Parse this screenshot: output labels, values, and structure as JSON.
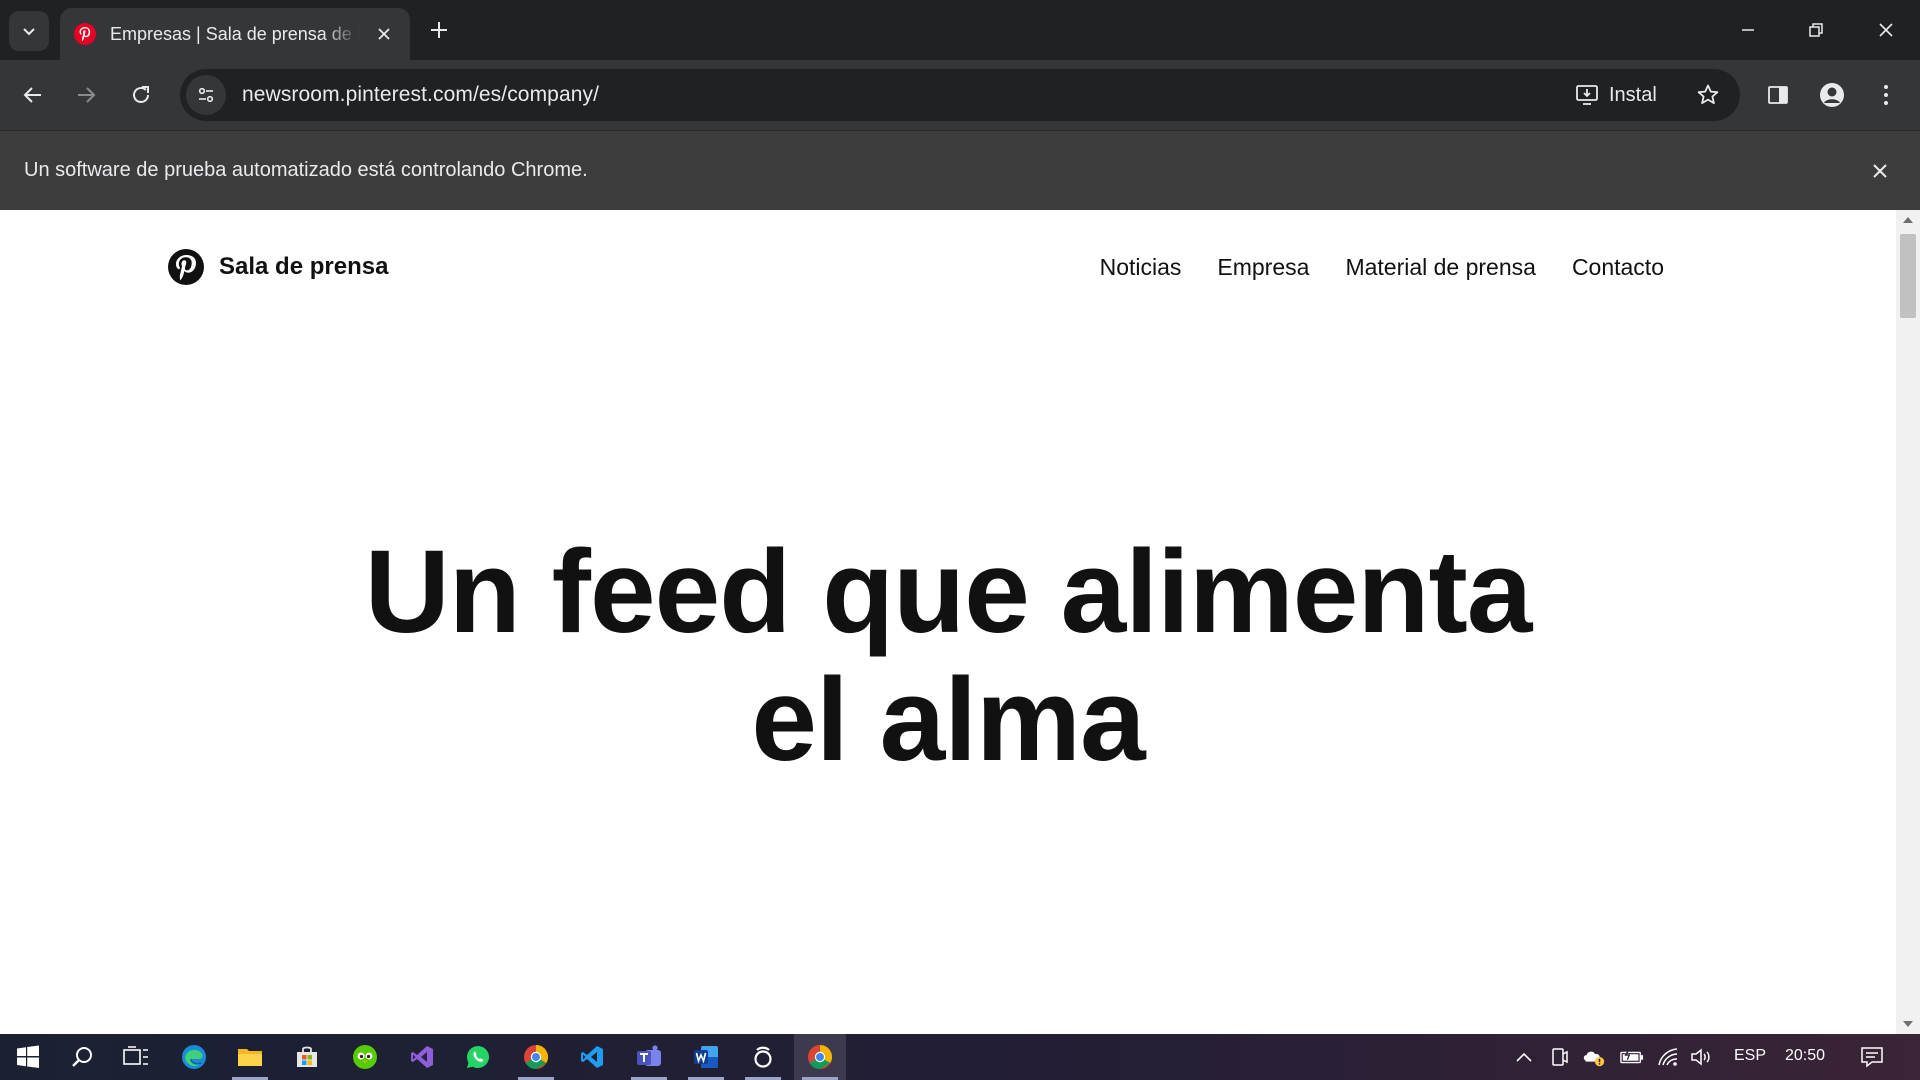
{
  "browser": {
    "tab_title": "Empresas | Sala de prensa de Pinterest",
    "url": "newsroom.pinterest.com/es/company/",
    "install_label": "Instal",
    "infobar_text": "Un software de prueba automatizado está controlando Chrome."
  },
  "site": {
    "brand": "Sala de prensa",
    "nav": [
      "Noticias",
      "Empresa",
      "Material de prensa",
      "Contacto"
    ],
    "hero_line1": "Un feed que alimenta",
    "hero_line2": "el alma"
  },
  "taskbar": {
    "language": "ESP",
    "time": "20:50",
    "apps": [
      "start",
      "search",
      "task-view",
      "edge",
      "file-explorer",
      "microsoft-store",
      "duolingo",
      "visual-studio",
      "whatsapp",
      "chrome",
      "vscode",
      "teams",
      "word",
      "copilot",
      "chrome-active"
    ]
  },
  "colors": {
    "pinterest_red": "#e60023",
    "chrome_dark": "#202124",
    "toolbar": "#35363a"
  }
}
